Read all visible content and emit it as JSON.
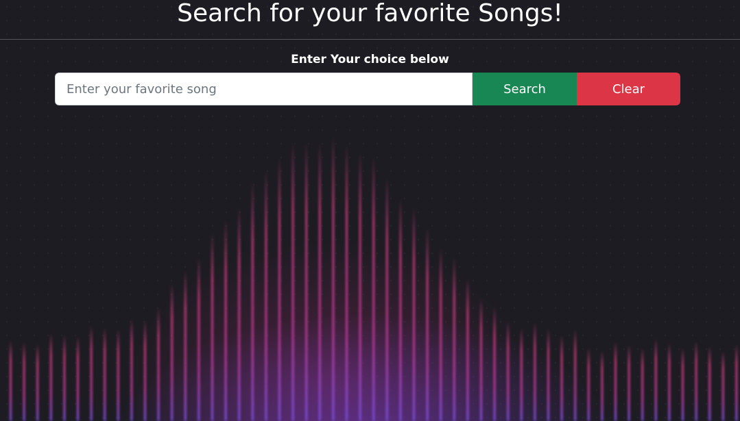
{
  "header": {
    "title": "Search for your favorite Songs!"
  },
  "search": {
    "prompt": "Enter Your choice below",
    "placeholder": "Enter your favorite song",
    "value": "",
    "search_label": "Search",
    "clear_label": "Clear"
  },
  "colors": {
    "background": "#1d1c22",
    "search_button": "#198754",
    "clear_button": "#dc3545",
    "equalizer_pink": "#e0407e",
    "equalizer_violet": "#7a4fe0"
  }
}
